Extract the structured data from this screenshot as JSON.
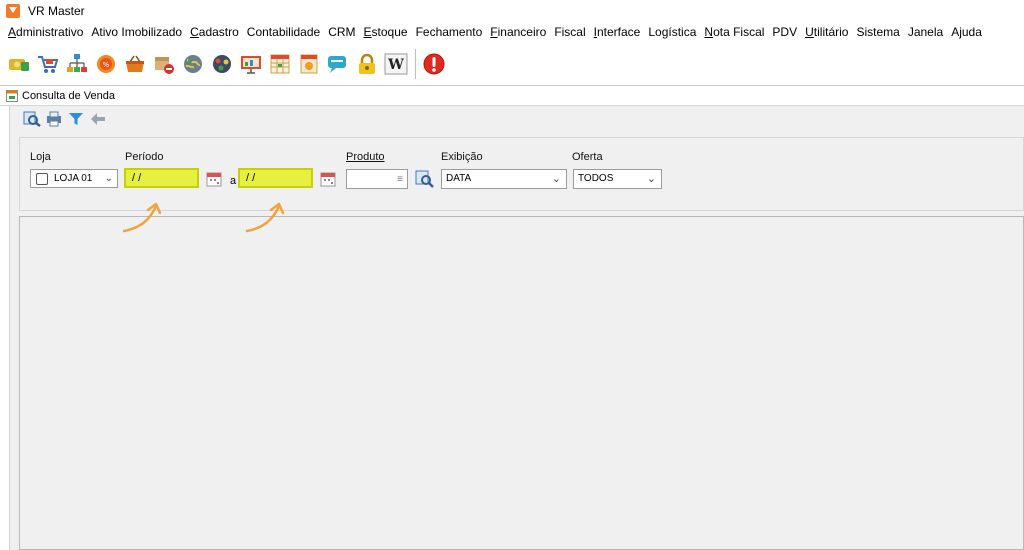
{
  "window": {
    "title": "VR Master"
  },
  "menu": [
    {
      "mn": "A",
      "rest": "dministrativo"
    },
    {
      "mn": "",
      "rest": "Ativo Imobilizado"
    },
    {
      "mn": "C",
      "rest": "adastro"
    },
    {
      "mn": "",
      "rest": "Contabilidade"
    },
    {
      "mn": "",
      "rest": "CRM"
    },
    {
      "mn": "E",
      "rest": "stoque"
    },
    {
      "mn": "",
      "rest": "Fechamento"
    },
    {
      "mn": "F",
      "rest": "inanceiro"
    },
    {
      "mn": "",
      "rest": "Fiscal"
    },
    {
      "mn": "I",
      "rest": "nterface"
    },
    {
      "mn": "",
      "rest": "Logística"
    },
    {
      "mn": "N",
      "rest": "ota Fiscal"
    },
    {
      "mn": "",
      "rest": "PDV"
    },
    {
      "mn": "U",
      "rest": "tilitário"
    },
    {
      "mn": "",
      "rest": "Sistema"
    },
    {
      "mn": "",
      "rest": "Janela"
    },
    {
      "mn": "",
      "rest": "Ajuda"
    }
  ],
  "internal_frame": {
    "title": "Consulta de Venda"
  },
  "filters": {
    "loja_label": "Loja",
    "loja_value": "LOJA 01",
    "periodo_label": "Período",
    "date_from": " / /",
    "a_label": "a",
    "date_to": " / /",
    "produto_label": "Produto",
    "exibicao_label": "Exibição",
    "exibicao_value": "DATA",
    "oferta_label": "Oferta",
    "oferta_value": "TODOS"
  },
  "toolbar_icons": [
    "cash-icon",
    "cart-icon",
    "org-chart-icon",
    "offer-badge-icon",
    "basket-icon",
    "box-remove-icon",
    "globe-green-icon",
    "globe-network-icon",
    "presentation-icon",
    "spreadsheet-icon",
    "document-icon",
    "chat-icon",
    "lock-icon",
    "wikipedia-icon"
  ],
  "colors": {
    "date_highlight": "#e6f040",
    "annotation_arrow": "#f2a33a"
  }
}
